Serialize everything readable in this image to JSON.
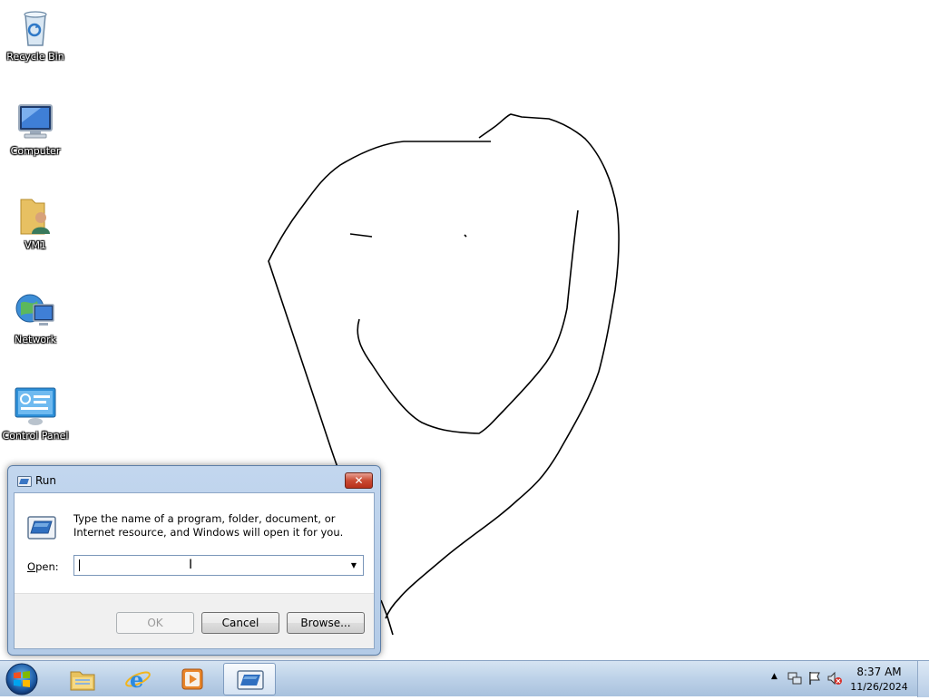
{
  "desktop": {
    "icons": [
      {
        "label": "Recycle Bin",
        "icon": "recycle-bin-icon"
      },
      {
        "label": "Computer",
        "icon": "computer-icon"
      },
      {
        "label": "VM1",
        "icon": "user-folder-icon"
      },
      {
        "label": "Network",
        "icon": "network-icon"
      },
      {
        "label": "Control Panel",
        "icon": "control-panel-icon"
      }
    ]
  },
  "run_dialog": {
    "title": "Run",
    "close_label": "✕",
    "description": "Type the name of a program, folder, document, or Internet resource, and Windows will open it for you.",
    "open_label_mnemonic": "O",
    "open_label_rest": "pen:",
    "open_value": "",
    "ok_label": "OK",
    "cancel_label": "Cancel",
    "browse_label": "Browse..."
  },
  "taskbar": {
    "pinned": [
      {
        "icon": "windows-explorer-icon"
      },
      {
        "icon": "internet-explorer-icon"
      },
      {
        "icon": "media-player-icon"
      },
      {
        "icon": "run-icon",
        "active": true
      }
    ],
    "tray": {
      "chevron": "▲",
      "icons": [
        "network-tray-icon",
        "action-center-flag-icon",
        "volume-muted-icon"
      ]
    },
    "clock": {
      "time": "8:37 AM",
      "date": "11/26/2024"
    }
  },
  "colors": {
    "close_button": "#c94a33",
    "taskbar": "#bcd1e8",
    "dialog_frame": "#b3cbe7"
  }
}
